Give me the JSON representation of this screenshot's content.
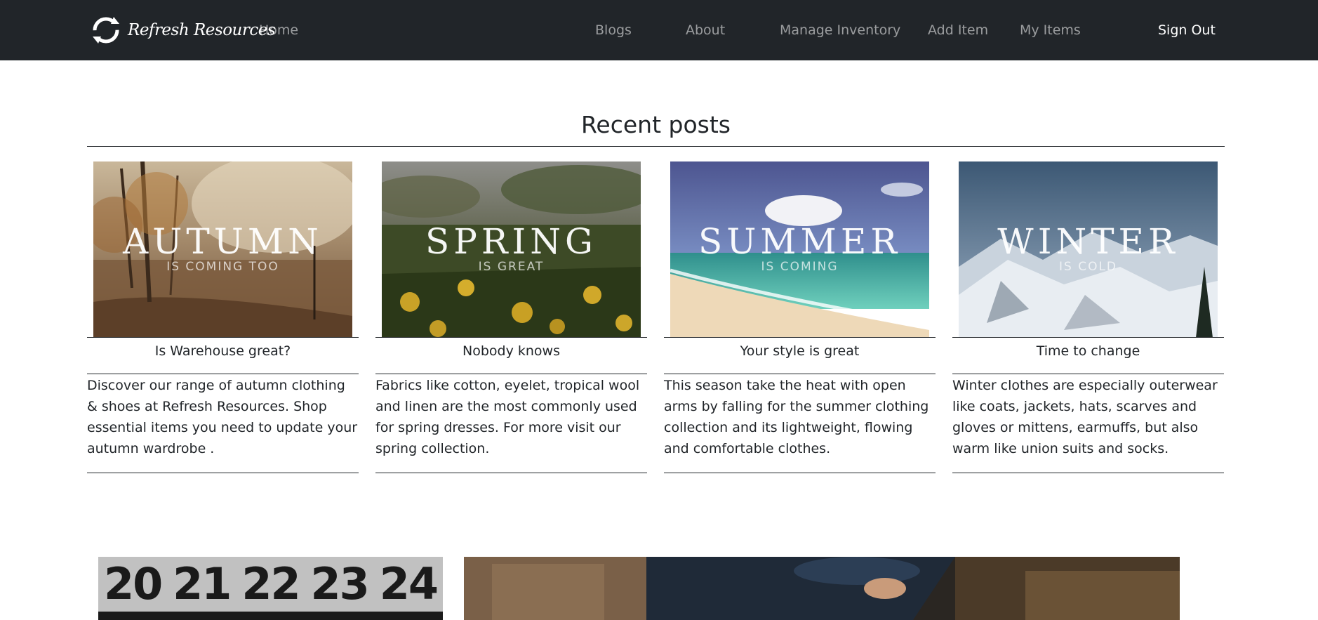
{
  "navbar": {
    "brand_text": "Refresh Resources",
    "links": {
      "home": "Home",
      "blogs": "Blogs",
      "about": "About",
      "manage_inventory": "Manage Inventory",
      "add_item": "Add Item",
      "my_items": "My Items",
      "sign_out": "Sign Out"
    }
  },
  "recent_posts": {
    "heading": "Recent posts",
    "cards": [
      {
        "image_word": "AUTUMN",
        "image_subtitle": "IS COMING TOO",
        "title": "Is Warehouse great?",
        "text": "Discover our range of autumn clothing & shoes at Refresh Resources. Shop essential items you need to update your autumn wardrobe ."
      },
      {
        "image_word": "SPRING",
        "image_subtitle": "IS GREAT",
        "title": "Nobody knows",
        "text": "Fabrics like cotton, eyelet, tropical wool and linen are the most commonly used for spring dresses. For more visit our spring collection."
      },
      {
        "image_word": "SUMMER",
        "image_subtitle": "IS COMING",
        "title": "Your style is great",
        "text": "This season take the heat with open arms by falling for the summer clothing collection and its lightweight, flowing and comfortable clothes."
      },
      {
        "image_word": "WINTER",
        "image_subtitle": "IS COLD",
        "title": "Time to change",
        "text": "Winter clothes are especially outerwear like coats, jackets, hats, scarves and gloves or mittens, earmuffs, but also warm like union suits and socks."
      }
    ]
  },
  "bottom_images": {
    "calendar_numbers": [
      "20",
      "21",
      "22",
      "23",
      "24"
    ]
  },
  "colors": {
    "navbar_bg": "#212529",
    "text": "#212529",
    "nav_link": "rgba(255,255,255,0.55)"
  },
  "icons": {
    "brand_logo": "refresh-arrows-icon"
  }
}
